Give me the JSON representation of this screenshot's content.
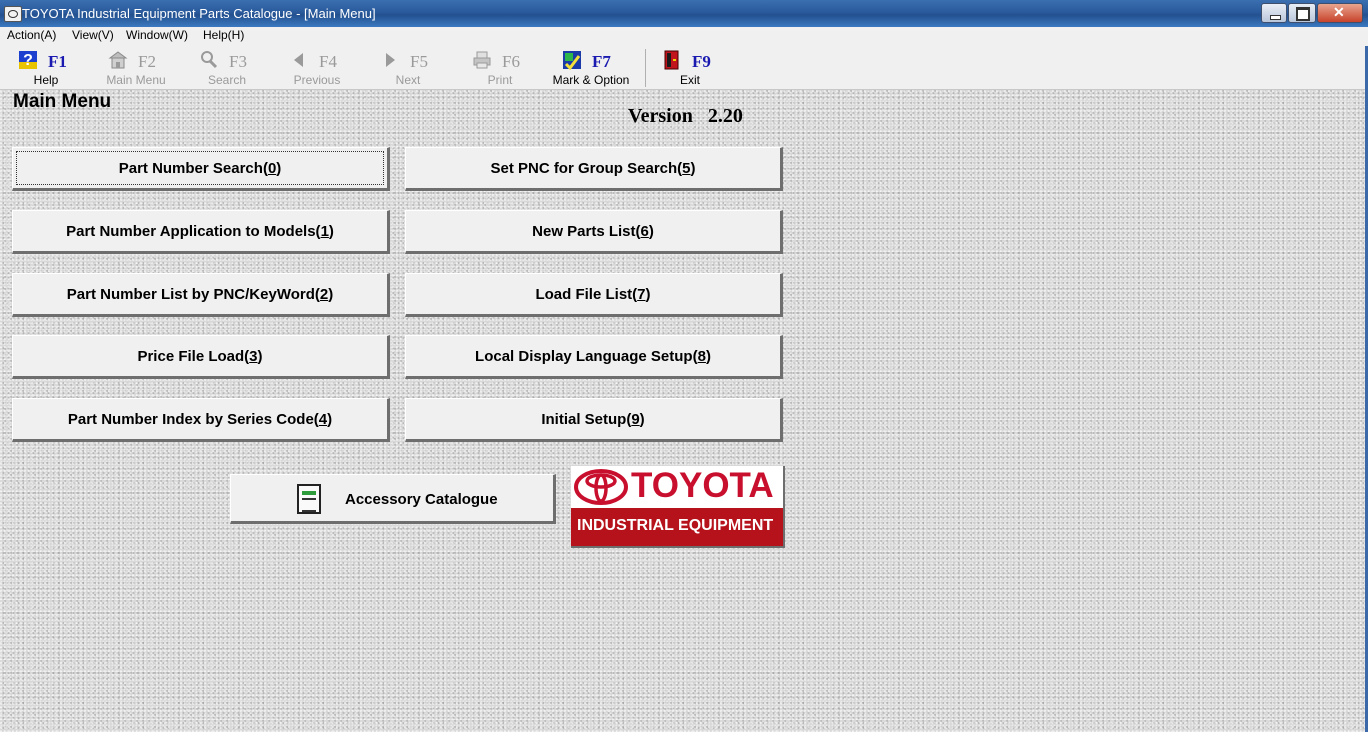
{
  "window": {
    "title": "TOYOTA Industrial Equipment Parts Catalogue - [Main Menu]"
  },
  "menubar": [
    "Action(A)",
    "View(V)",
    "Window(W)",
    "Help(H)"
  ],
  "toolbar": [
    {
      "key": "F1",
      "label": "Help",
      "icon": "help-icon",
      "enabled": true
    },
    {
      "key": "F2",
      "label": "Main Menu",
      "icon": "main-menu-icon",
      "enabled": false
    },
    {
      "key": "F3",
      "label": "Search",
      "icon": "search-icon",
      "enabled": false
    },
    {
      "key": "F4",
      "label": "Previous",
      "icon": "arrow-left-icon",
      "enabled": false
    },
    {
      "key": "F5",
      "label": "Next",
      "icon": "arrow-right-icon",
      "enabled": false
    },
    {
      "key": "F6",
      "label": "Print",
      "icon": "printer-icon",
      "enabled": false
    },
    {
      "key": "F7",
      "label": "Mark & Option",
      "icon": "mark-option-icon",
      "enabled": true
    },
    {
      "key": "F9",
      "label": "Exit",
      "icon": "exit-icon",
      "enabled": true
    }
  ],
  "main": {
    "title": "Main Menu",
    "version": "Version   2.20",
    "buttons_left": [
      {
        "text": "Part Number Search(",
        "key": "0",
        "close": ")"
      },
      {
        "text": "Part Number Application to Models(",
        "key": "1",
        "close": ")"
      },
      {
        "text": "Part Number List by PNC/KeyWord(",
        "key": "2",
        "close": ")"
      },
      {
        "text": "Price File Load(",
        "key": "3",
        "close": ")"
      },
      {
        "text": "Part Number Index by Series Code(",
        "key": "4",
        "close": ")"
      }
    ],
    "buttons_right": [
      {
        "text": "Set PNC for Group Search(",
        "key": "5",
        "close": ")"
      },
      {
        "text": "New Parts List(",
        "key": "6",
        "close": ")"
      },
      {
        "text": "Load File List(",
        "key": "7",
        "close": ")"
      },
      {
        "text": "Local Display Language Setup(",
        "key": "8",
        "close": ")"
      },
      {
        "text": "Initial Setup(",
        "key": "9",
        "close": ")"
      }
    ],
    "accessory_button": "Accessory Catalogue",
    "logo": {
      "word": "TOYOTA",
      "subtitle": "INDUSTRIAL EQUIPMENT",
      "brand_color": "#b5121b"
    }
  }
}
